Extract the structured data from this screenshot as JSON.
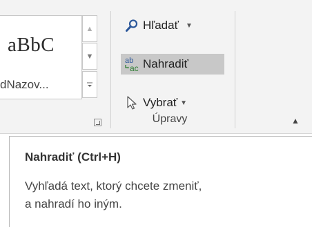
{
  "styles": {
    "preview_text": "aBbC",
    "style_name": "dNazov..."
  },
  "editing": {
    "find_label": "Hľadať",
    "replace_label": "Nahradiť",
    "select_label": "Vybrať",
    "group_label": "Úpravy"
  },
  "tooltip": {
    "title": "Nahradiť (Ctrl+H)",
    "desc_line1": "Vyhľadá text, ktorý chcete zmeniť,",
    "desc_line2": "a nahradí ho iným."
  },
  "icons": {
    "find": "magnifier-icon",
    "replace": "ab-ac-replace-icon",
    "select": "cursor-arrow-icon"
  },
  "colors": {
    "ribbon_bg": "#f3f3f3",
    "hover_bg": "#c8c8c8",
    "find_icon": "#2b579a",
    "replace_icon_top": "#2b579a",
    "replace_icon_bottom": "#2e7d32"
  }
}
